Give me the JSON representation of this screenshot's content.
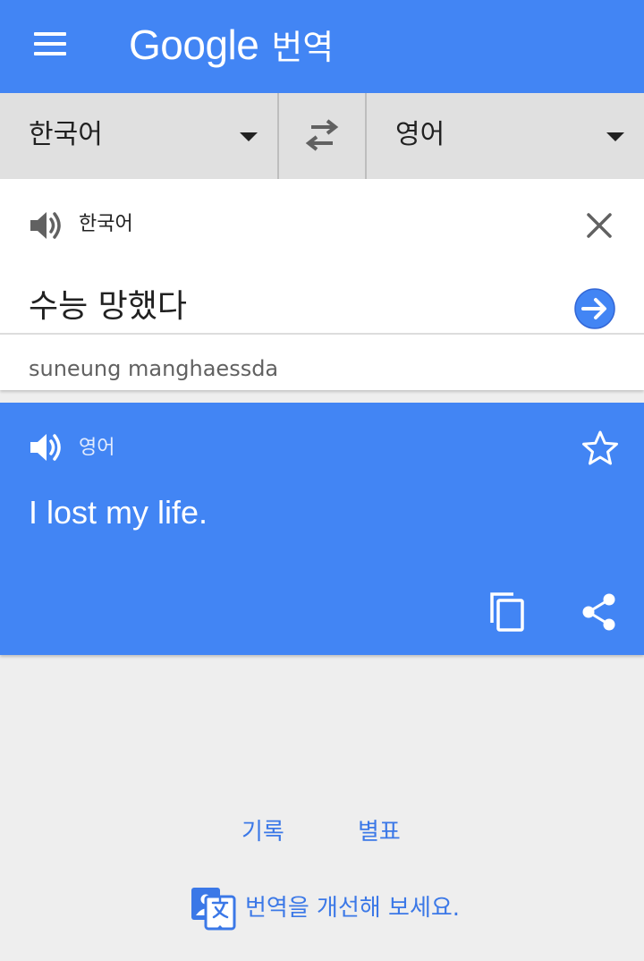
{
  "app": {
    "brand": "Google",
    "title_suffix": "번역"
  },
  "colors": {
    "primary": "#4285f4",
    "background": "#eeeeee",
    "language_bar": "#e0e0e0",
    "link": "#3b78e7"
  },
  "icons": {
    "menu": "menu-icon",
    "swap": "swap-arrows-icon",
    "speaker": "speaker-icon",
    "clear": "close-icon",
    "translate_go": "arrow-right-circle-icon",
    "star": "star-outline-icon",
    "copy": "copy-icon",
    "share": "share-icon",
    "improve": "translate-community-icon"
  },
  "language_bar": {
    "source_language": "한국어",
    "target_language": "영어"
  },
  "input": {
    "language_label": "한국어",
    "text": "수능 망했다",
    "romanization": "suneung manghaessda"
  },
  "result": {
    "language_label": "영어",
    "text": "I lost my life."
  },
  "footer": {
    "history_label": "기록",
    "phrasebook_label": "별표",
    "improve_label": "번역을 개선해 보세요."
  }
}
